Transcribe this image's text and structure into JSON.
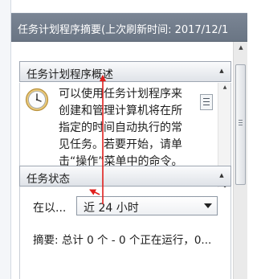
{
  "window": {
    "title": "任务计划程序摘要(上次刷新时间: 2017/12/1"
  },
  "overview_panel": {
    "header": "任务计划程序概述",
    "collapse_glyph": "▲",
    "description_lines": [
      "可以使用任务计划程序来",
      "创建和管理计算机将在所",
      "指定的时间自动执行的常",
      "见任务。若要开始，请单",
      "击“操作”菜单中的命令。"
    ]
  },
  "status_panel": {
    "header": "任务状态",
    "collapse_glyph": "▲",
    "period_label": "在以...",
    "period_value": "近 24 小时",
    "summary": "摘要: 总计 0 个 - 0 个正在运行，0..."
  },
  "colors": {
    "title_bar": "#6f7a89",
    "annotation_arrow": "#e0201e"
  },
  "icons": [
    "clock-icon",
    "document-list-icon",
    "dropdown-arrow-icon",
    "collapse-icon"
  ]
}
